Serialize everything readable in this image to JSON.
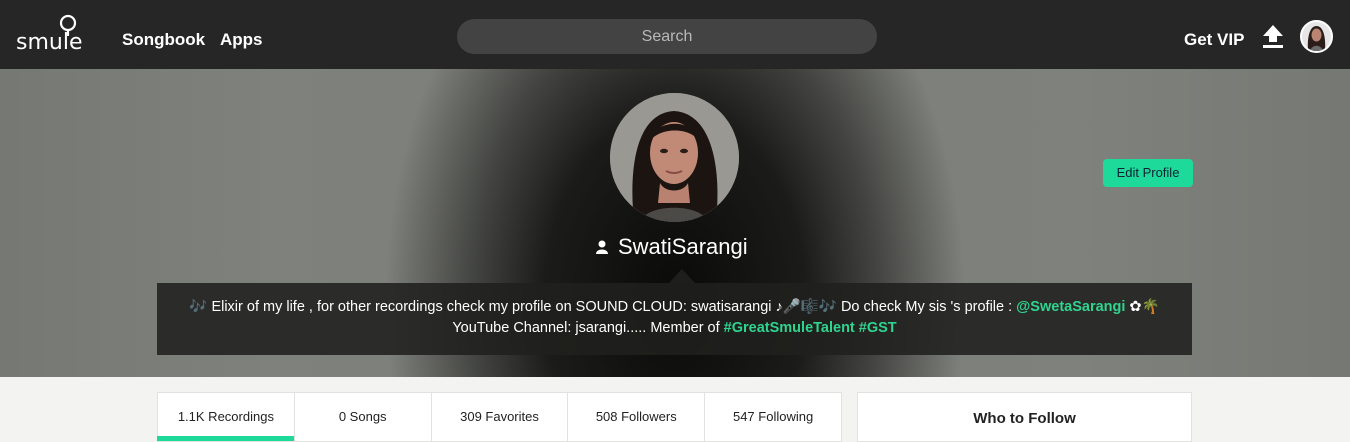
{
  "nav": {
    "logo_text": "smule",
    "links": [
      {
        "label": "Songbook"
      },
      {
        "label": "Apps"
      }
    ],
    "search_placeholder": "Search",
    "get_vip": "Get VIP"
  },
  "profile": {
    "username": "SwatiSarangi",
    "edit_label": "Edit Profile",
    "bio": {
      "part1": "🎶 Elixir of my life , for other recordings check my profile on SOUND CLOUD: swatisarangi ♪🎤🎼🎶 Do check My sis 's profile : ",
      "mention": "@SwetaSarangi",
      "part2": " ✿🌴",
      "part3": "YouTube Channel: jsarangi..... Member of ",
      "hashtag1": "#GreatSmuleTalent",
      "hashtag2": "#GST"
    }
  },
  "stats": [
    {
      "label": "1.1K Recordings",
      "active": true
    },
    {
      "label": "0 Songs"
    },
    {
      "label": "309 Favorites"
    },
    {
      "label": "508 Followers"
    },
    {
      "label": "547 Following"
    }
  ],
  "sidebar": {
    "who_to_follow": "Who to Follow"
  },
  "colors": {
    "accent": "#1dd99a",
    "link": "#2fd48f",
    "topbar": "#262626"
  }
}
